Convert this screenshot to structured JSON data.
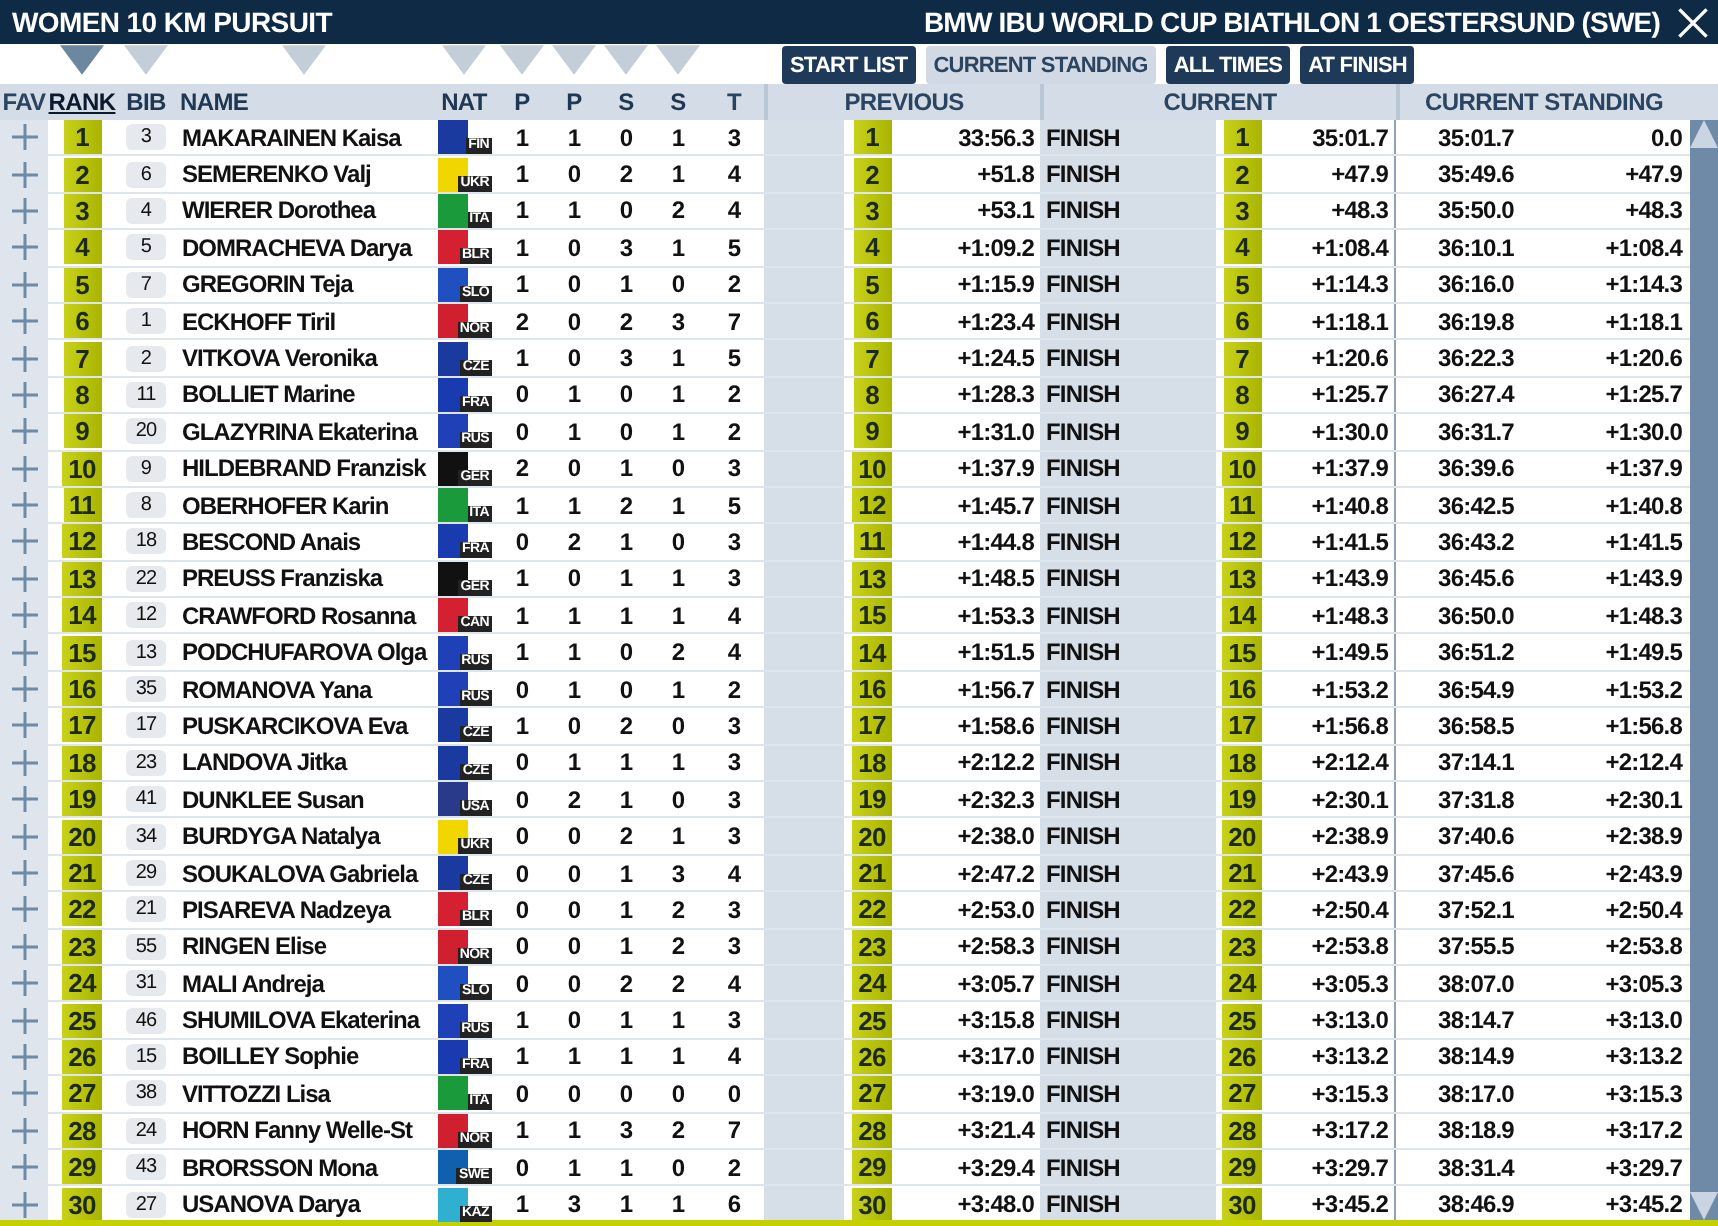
{
  "window": {
    "title": "WOMEN 10 KM PURSUIT",
    "event": "BMW IBU WORLD CUP BIATHLON 1 OESTERSUND (SWE)"
  },
  "tabs": [
    {
      "label": "START LIST",
      "selected": false
    },
    {
      "label": "CURRENT STANDING",
      "selected": true
    },
    {
      "label": "ALL TIMES",
      "selected": false
    },
    {
      "label": "AT FINISH",
      "selected": false
    }
  ],
  "columns": [
    {
      "label": "FAV",
      "sortable": false,
      "selected": false
    },
    {
      "label": "RANK",
      "sortable": true,
      "selected": true
    },
    {
      "label": "BIB",
      "sortable": true,
      "selected": false
    },
    {
      "label": "NAME",
      "sortable": true,
      "selected": false
    },
    {
      "label": "NAT",
      "sortable": true,
      "selected": false
    },
    {
      "label": "P",
      "sortable": true,
      "selected": false
    },
    {
      "label": "P",
      "sortable": true,
      "selected": false
    },
    {
      "label": "S",
      "sortable": true,
      "selected": false
    },
    {
      "label": "S",
      "sortable": true,
      "selected": false
    },
    {
      "label": "T",
      "sortable": false,
      "selected": false
    }
  ],
  "groups": [
    "PREVIOUS",
    "CURRENT",
    "CURRENT STANDING"
  ],
  "rows": [
    {
      "rank": "1",
      "bib": "3",
      "name": "MAKARAINEN Kaisa",
      "nat": "FIN",
      "color": "#1a3aa0",
      "shots": [
        "1",
        "1",
        "0",
        "1",
        "3"
      ],
      "prev_rank": "1",
      "prev_time": "33:56.3",
      "status": "FINISH",
      "cur_rank": "1",
      "cur_time": "35:01.7",
      "total": "35:01.7",
      "gap": "0.0"
    },
    {
      "rank": "2",
      "bib": "6",
      "name": "SEMERENKO Valj",
      "nat": "UKR",
      "color": "#f2d600",
      "shots": [
        "1",
        "0",
        "2",
        "1",
        "4"
      ],
      "prev_rank": "2",
      "prev_time": "+51.8",
      "status": "FINISH",
      "cur_rank": "2",
      "cur_time": "+47.9",
      "total": "35:49.6",
      "gap": "+47.9"
    },
    {
      "rank": "3",
      "bib": "4",
      "name": "WIERER Dorothea",
      "nat": "ITA",
      "color": "#1a9a3a",
      "shots": [
        "1",
        "1",
        "0",
        "2",
        "4"
      ],
      "prev_rank": "3",
      "prev_time": "+53.1",
      "status": "FINISH",
      "cur_rank": "3",
      "cur_time": "+48.3",
      "total": "35:50.0",
      "gap": "+48.3"
    },
    {
      "rank": "4",
      "bib": "5",
      "name": "DOMRACHEVA Darya",
      "nat": "BLR",
      "color": "#d42030",
      "shots": [
        "1",
        "0",
        "3",
        "1",
        "5"
      ],
      "prev_rank": "4",
      "prev_time": "+1:09.2",
      "status": "FINISH",
      "cur_rank": "4",
      "cur_time": "+1:08.4",
      "total": "36:10.1",
      "gap": "+1:08.4"
    },
    {
      "rank": "5",
      "bib": "7",
      "name": "GREGORIN Teja",
      "nat": "SLO",
      "color": "#2050c0",
      "shots": [
        "1",
        "0",
        "1",
        "0",
        "2"
      ],
      "prev_rank": "5",
      "prev_time": "+1:15.9",
      "status": "FINISH",
      "cur_rank": "5",
      "cur_time": "+1:14.3",
      "total": "36:16.0",
      "gap": "+1:14.3"
    },
    {
      "rank": "6",
      "bib": "1",
      "name": "ECKHOFF Tiril",
      "nat": "NOR",
      "color": "#d02030",
      "shots": [
        "2",
        "0",
        "2",
        "3",
        "7"
      ],
      "prev_rank": "6",
      "prev_time": "+1:23.4",
      "status": "FINISH",
      "cur_rank": "6",
      "cur_time": "+1:18.1",
      "total": "36:19.8",
      "gap": "+1:18.1"
    },
    {
      "rank": "7",
      "bib": "2",
      "name": "VITKOVA Veronika",
      "nat": "CZE",
      "color": "#1a3aa0",
      "shots": [
        "1",
        "0",
        "3",
        "1",
        "5"
      ],
      "prev_rank": "7",
      "prev_time": "+1:24.5",
      "status": "FINISH",
      "cur_rank": "7",
      "cur_time": "+1:20.6",
      "total": "36:22.3",
      "gap": "+1:20.6"
    },
    {
      "rank": "8",
      "bib": "11",
      "name": "BOLLIET Marine",
      "nat": "FRA",
      "color": "#1a3ab0",
      "shots": [
        "0",
        "1",
        "0",
        "1",
        "2"
      ],
      "prev_rank": "8",
      "prev_time": "+1:28.3",
      "status": "FINISH",
      "cur_rank": "8",
      "cur_time": "+1:25.7",
      "total": "36:27.4",
      "gap": "+1:25.7"
    },
    {
      "rank": "9",
      "bib": "20",
      "name": "GLAZYRINA Ekaterina",
      "nat": "RUS",
      "color": "#2040b8",
      "shots": [
        "0",
        "1",
        "0",
        "1",
        "2"
      ],
      "prev_rank": "9",
      "prev_time": "+1:31.0",
      "status": "FINISH",
      "cur_rank": "9",
      "cur_time": "+1:30.0",
      "total": "36:31.7",
      "gap": "+1:30.0"
    },
    {
      "rank": "10",
      "bib": "9",
      "name": "HILDEBRAND Franzisk",
      "nat": "GER",
      "color": "#111111",
      "shots": [
        "2",
        "0",
        "1",
        "0",
        "3"
      ],
      "prev_rank": "10",
      "prev_time": "+1:37.9",
      "status": "FINISH",
      "cur_rank": "10",
      "cur_time": "+1:37.9",
      "total": "36:39.6",
      "gap": "+1:37.9"
    },
    {
      "rank": "11",
      "bib": "8",
      "name": "OBERHOFER Karin",
      "nat": "ITA",
      "color": "#1a9a3a",
      "shots": [
        "1",
        "1",
        "2",
        "1",
        "5"
      ],
      "prev_rank": "12",
      "prev_time": "+1:45.7",
      "status": "FINISH",
      "cur_rank": "11",
      "cur_time": "+1:40.8",
      "total": "36:42.5",
      "gap": "+1:40.8"
    },
    {
      "rank": "12",
      "bib": "18",
      "name": "BESCOND Anais",
      "nat": "FRA",
      "color": "#1a3ab0",
      "shots": [
        "0",
        "2",
        "1",
        "0",
        "3"
      ],
      "prev_rank": "11",
      "prev_time": "+1:44.8",
      "status": "FINISH",
      "cur_rank": "12",
      "cur_time": "+1:41.5",
      "total": "36:43.2",
      "gap": "+1:41.5"
    },
    {
      "rank": "13",
      "bib": "22",
      "name": "PREUSS Franziska",
      "nat": "GER",
      "color": "#111111",
      "shots": [
        "1",
        "0",
        "1",
        "1",
        "3"
      ],
      "prev_rank": "13",
      "prev_time": "+1:48.5",
      "status": "FINISH",
      "cur_rank": "13",
      "cur_time": "+1:43.9",
      "total": "36:45.6",
      "gap": "+1:43.9"
    },
    {
      "rank": "14",
      "bib": "12",
      "name": "CRAWFORD Rosanna",
      "nat": "CAN",
      "color": "#d42030",
      "shots": [
        "1",
        "1",
        "1",
        "1",
        "4"
      ],
      "prev_rank": "15",
      "prev_time": "+1:53.3",
      "status": "FINISH",
      "cur_rank": "14",
      "cur_time": "+1:48.3",
      "total": "36:50.0",
      "gap": "+1:48.3"
    },
    {
      "rank": "15",
      "bib": "13",
      "name": "PODCHUFAROVA Olga",
      "nat": "RUS",
      "color": "#2040b8",
      "shots": [
        "1",
        "1",
        "0",
        "2",
        "4"
      ],
      "prev_rank": "14",
      "prev_time": "+1:51.5",
      "status": "FINISH",
      "cur_rank": "15",
      "cur_time": "+1:49.5",
      "total": "36:51.2",
      "gap": "+1:49.5"
    },
    {
      "rank": "16",
      "bib": "35",
      "name": "ROMANOVA Yana",
      "nat": "RUS",
      "color": "#2040b8",
      "shots": [
        "0",
        "1",
        "0",
        "1",
        "2"
      ],
      "prev_rank": "16",
      "prev_time": "+1:56.7",
      "status": "FINISH",
      "cur_rank": "16",
      "cur_time": "+1:53.2",
      "total": "36:54.9",
      "gap": "+1:53.2"
    },
    {
      "rank": "17",
      "bib": "17",
      "name": "PUSKARCIKOVA Eva",
      "nat": "CZE",
      "color": "#1a3aa0",
      "shots": [
        "1",
        "0",
        "2",
        "0",
        "3"
      ],
      "prev_rank": "17",
      "prev_time": "+1:58.6",
      "status": "FINISH",
      "cur_rank": "17",
      "cur_time": "+1:56.8",
      "total": "36:58.5",
      "gap": "+1:56.8"
    },
    {
      "rank": "18",
      "bib": "23",
      "name": "LANDOVA Jitka",
      "nat": "CZE",
      "color": "#1a3aa0",
      "shots": [
        "0",
        "1",
        "1",
        "1",
        "3"
      ],
      "prev_rank": "18",
      "prev_time": "+2:12.2",
      "status": "FINISH",
      "cur_rank": "18",
      "cur_time": "+2:12.4",
      "total": "37:14.1",
      "gap": "+2:12.4"
    },
    {
      "rank": "19",
      "bib": "41",
      "name": "DUNKLEE Susan",
      "nat": "USA",
      "color": "#2a3a8a",
      "shots": [
        "0",
        "2",
        "1",
        "0",
        "3"
      ],
      "prev_rank": "19",
      "prev_time": "+2:32.3",
      "status": "FINISH",
      "cur_rank": "19",
      "cur_time": "+2:30.1",
      "total": "37:31.8",
      "gap": "+2:30.1"
    },
    {
      "rank": "20",
      "bib": "34",
      "name": "BURDYGA Natalya",
      "nat": "UKR",
      "color": "#f2d600",
      "shots": [
        "0",
        "0",
        "2",
        "1",
        "3"
      ],
      "prev_rank": "20",
      "prev_time": "+2:38.0",
      "status": "FINISH",
      "cur_rank": "20",
      "cur_time": "+2:38.9",
      "total": "37:40.6",
      "gap": "+2:38.9"
    },
    {
      "rank": "21",
      "bib": "29",
      "name": "SOUKALOVA Gabriela",
      "nat": "CZE",
      "color": "#1a3aa0",
      "shots": [
        "0",
        "0",
        "1",
        "3",
        "4"
      ],
      "prev_rank": "21",
      "prev_time": "+2:47.2",
      "status": "FINISH",
      "cur_rank": "21",
      "cur_time": "+2:43.9",
      "total": "37:45.6",
      "gap": "+2:43.9"
    },
    {
      "rank": "22",
      "bib": "21",
      "name": "PISAREVA  Nadzeya",
      "nat": "BLR",
      "color": "#d42030",
      "shots": [
        "0",
        "0",
        "1",
        "2",
        "3"
      ],
      "prev_rank": "22",
      "prev_time": "+2:53.0",
      "status": "FINISH",
      "cur_rank": "22",
      "cur_time": "+2:50.4",
      "total": "37:52.1",
      "gap": "+2:50.4"
    },
    {
      "rank": "23",
      "bib": "55",
      "name": "RINGEN Elise",
      "nat": "NOR",
      "color": "#d02030",
      "shots": [
        "0",
        "0",
        "1",
        "2",
        "3"
      ],
      "prev_rank": "23",
      "prev_time": "+2:58.3",
      "status": "FINISH",
      "cur_rank": "23",
      "cur_time": "+2:53.8",
      "total": "37:55.5",
      "gap": "+2:53.8"
    },
    {
      "rank": "24",
      "bib": "31",
      "name": "MALI Andreja",
      "nat": "SLO",
      "color": "#2050c0",
      "shots": [
        "0",
        "0",
        "2",
        "2",
        "4"
      ],
      "prev_rank": "24",
      "prev_time": "+3:05.7",
      "status": "FINISH",
      "cur_rank": "24",
      "cur_time": "+3:05.3",
      "total": "38:07.0",
      "gap": "+3:05.3"
    },
    {
      "rank": "25",
      "bib": "46",
      "name": "SHUMILOVA Ekaterina",
      "nat": "RUS",
      "color": "#2040b8",
      "shots": [
        "1",
        "0",
        "1",
        "1",
        "3"
      ],
      "prev_rank": "25",
      "prev_time": "+3:15.8",
      "status": "FINISH",
      "cur_rank": "25",
      "cur_time": "+3:13.0",
      "total": "38:14.7",
      "gap": "+3:13.0"
    },
    {
      "rank": "26",
      "bib": "15",
      "name": "BOILLEY Sophie",
      "nat": "FRA",
      "color": "#1a3ab0",
      "shots": [
        "1",
        "1",
        "1",
        "1",
        "4"
      ],
      "prev_rank": "26",
      "prev_time": "+3:17.0",
      "status": "FINISH",
      "cur_rank": "26",
      "cur_time": "+3:13.2",
      "total": "38:14.9",
      "gap": "+3:13.2"
    },
    {
      "rank": "27",
      "bib": "38",
      "name": "VITTOZZI Lisa",
      "nat": "ITA",
      "color": "#1a9a3a",
      "shots": [
        "0",
        "0",
        "0",
        "0",
        "0"
      ],
      "prev_rank": "27",
      "prev_time": "+3:19.0",
      "status": "FINISH",
      "cur_rank": "27",
      "cur_time": "+3:15.3",
      "total": "38:17.0",
      "gap": "+3:15.3"
    },
    {
      "rank": "28",
      "bib": "24",
      "name": "HORN Fanny Welle-St",
      "nat": "NOR",
      "color": "#d02030",
      "shots": [
        "1",
        "1",
        "3",
        "2",
        "7"
      ],
      "prev_rank": "28",
      "prev_time": "+3:21.4",
      "status": "FINISH",
      "cur_rank": "28",
      "cur_time": "+3:17.2",
      "total": "38:18.9",
      "gap": "+3:17.2"
    },
    {
      "rank": "29",
      "bib": "43",
      "name": "BRORSSON Mona",
      "nat": "SWE",
      "color": "#1060b0",
      "shots": [
        "0",
        "1",
        "1",
        "0",
        "2"
      ],
      "prev_rank": "29",
      "prev_time": "+3:29.4",
      "status": "FINISH",
      "cur_rank": "29",
      "cur_time": "+3:29.7",
      "total": "38:31.4",
      "gap": "+3:29.7"
    },
    {
      "rank": "30",
      "bib": "27",
      "name": "USANOVA Darya",
      "nat": "KAZ",
      "color": "#30b0d0",
      "shots": [
        "1",
        "3",
        "1",
        "1",
        "6"
      ],
      "prev_rank": "30",
      "prev_time": "+3:48.0",
      "status": "FINISH",
      "cur_rank": "30",
      "cur_time": "+3:45.2",
      "total": "38:46.9",
      "gap": "+3:45.2"
    }
  ]
}
